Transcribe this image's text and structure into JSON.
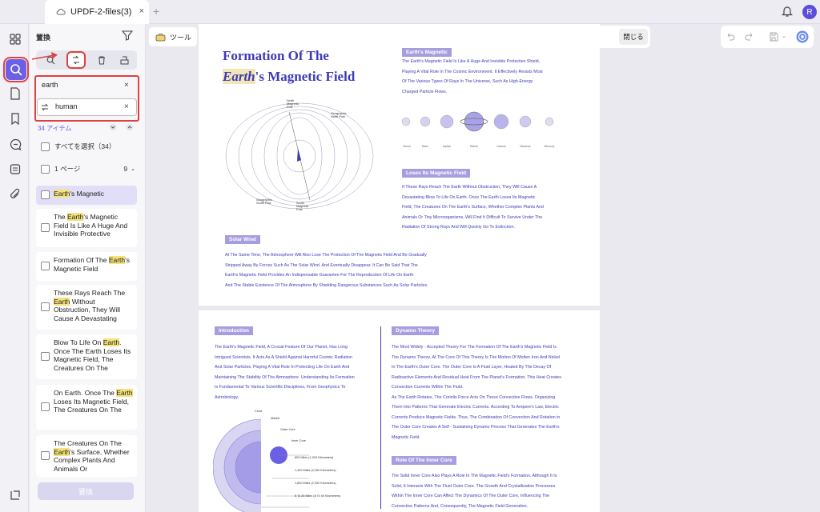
{
  "tab": {
    "title": "UPDF-2-files(3)",
    "close": "×",
    "new_tab": "+"
  },
  "user": {
    "avatar_letter": "R"
  },
  "panel": {
    "title": "置換",
    "search_value": "earth",
    "replace_value": "human",
    "clear": "×",
    "count_label": "34 アイテム",
    "select_all": "すべてを選択（34）",
    "page_group": "1 ページ",
    "page_count": "9",
    "replace_button": "置換",
    "results": [
      {
        "pre": "",
        "match": "Earth",
        "post": "'s Magnetic"
      },
      {
        "pre": "The ",
        "match": "Earth",
        "post": "'s Magnetic Field Is Like A Huge And Invisible Protective"
      },
      {
        "pre": "Formation Of The ",
        "match": "Earth",
        "post": "'s Magnetic Field"
      },
      {
        "pre": "These Rays Reach The ",
        "match": "Earth",
        "post": " Without Obstruction, They Will Cause A Devastating"
      },
      {
        "pre": "Blow To Life On ",
        "match": "Earth",
        "post": ". Once The Earth Loses Its Magnetic Field, The Creatures On The"
      },
      {
        "pre": "On Earth. Once The ",
        "match": "Earth",
        "post": " Loses Its Magnetic Field, The Creatures On The"
      },
      {
        "pre": "The Creatures On The ",
        "match": "Earth",
        "post": "'s Surface, Whether Complex Plants And Animals Or"
      }
    ]
  },
  "toolbar": {
    "tool_label": "ツール",
    "close_label": "閉じる"
  },
  "doc": {
    "page1": {
      "title_line1": "Formation Of The",
      "title_line2_italic": "Earth",
      "title_line2_rest": "'s Magnetic Field",
      "heading_magnetic": "Earth's Magnetic",
      "magnetic_text": [
        "The Earth's Magnetic Field Is Like A Huge And Invisible Protective Shield,",
        "Playing A Vital Role In The Cosmic Environment. It Effectively Resists Most",
        "Of The Various Types Of Rays In The Universe, Such As High-Energy",
        "Charged Particle Flows."
      ],
      "planets": [
        "Venus",
        "Mars",
        "Jupiter",
        "Saturn",
        "Uranus",
        "Neptune",
        "Mercury"
      ],
      "heading_loses": "Loses Its Magnetic Field",
      "loses_text": [
        "If These Rays Reach The Earth Without Obstruction, They Will Cause A",
        "Devastating Blow To Life On Earth. Once The Earth Loses Its Magnetic",
        "Field, The Creatures On The Earth's Surface, Whether Complex Plants And",
        "Animals Or Tiny Microorganisms, Will Find It Difficult To Survive Under The",
        "Radiation Of Strong Rays And Will Quickly Go To Extinction."
      ],
      "heading_solar": "Solar Wind",
      "solar_text": [
        "At The Same Time, The Atmosphere Will Also Lose The Protection Of The Magnetic Field And Be Gradually",
        "Stripped Away By Forces Such As The Solar Wind. And Eventually Disappear. It Can Be Said That The",
        "Earth's Magnetic Field Provides An Indispensable Guarantee For The Reproduction Of Life On Earth",
        "And The Stable Existence Of The Atmosphere By Shielding Dangerous Substances Such As Solar Particles."
      ],
      "diagram_labels": {
        "north_mag": "North Magnetic Pole",
        "geo_north": "Geographic North Pole",
        "geo_south": "Geographic South Pole",
        "south_mag": "South Magnetic Pole"
      }
    },
    "page2": {
      "heading_intro": "Introduction",
      "intro_text": [
        "The Earth's Magnetic Field, A Crucial Feature Of Our Planet, Has Long",
        "Intrigued Scientists. It Acts As A Shield Against Harmful Cosmic Radiation",
        "And Solar Particles, Playing A Vital Role In Protecting Life On Earth And",
        "Maintaining The Stability Of The Atmosphere. Understanding Its Formation",
        "Is Fundamental To Various Scientific Disciplines, From Geophysics To",
        "Astrobiology."
      ],
      "layers": [
        "Crust",
        "Mantle",
        "Outer Core",
        "Inner Core"
      ],
      "distances": [
        "800 Miles (1,300 Kilometers)",
        "1,400 Miles (2,250 Kilometers)",
        "1,800 Miles (2,900 Kilometers)",
        "5 To 25 Miles (8 To 40 Kilometers)"
      ],
      "heading_dynamo": "Dynamo Theory",
      "dynamo_text": [
        "The Most Widely - Accepted Theory For The Formation Of The Earth's Magnetic Field Is",
        "The Dynamo Theory. At The Core Of This Theory Is The Motion Of Molten Iron And Nickel",
        "In The Earth's Outer Core. The Outer Core Is A Fluid Layer, Heated By The Decay Of",
        "Radioactive Elements And Residual Heat From The Planet's Formation. This Heat Creates",
        "Convection Currents Within The Fluid.",
        "As The Earth Rotates, The Coriolis Force Acts On These Convective Flows, Organizing",
        "Them Into Patterns That Generate Electric Currents. According To Ampere's Law, Electric",
        "Currents Produce Magnetic Fields. Thus, The Combination Of Convection And Rotation in",
        "The Outer Core Creates A Self - Sustaining Dynamo Process That Generates The Earth's",
        "Magnetic Field."
      ],
      "heading_inner": "Role Of The Inner Core",
      "inner_text": [
        "The Solid Inner Core Also Plays A Role In The Magnetic Field's Formation. Although It Is",
        "Solid, It Interacts With The Fluid Outer Core. The Growth And Crystallization Processes",
        "Within The Inner Core Can Affect The Dynamics Of The Outer Core, Influencing The",
        "Convective Patterns And, Consequently, The Magnetic Field Generation."
      ]
    }
  },
  "colors": {
    "accent": "#6b5fe6",
    "doc_text": "#3e3bb5",
    "highlight": "#f5e27a",
    "annotation": "#e04040"
  }
}
